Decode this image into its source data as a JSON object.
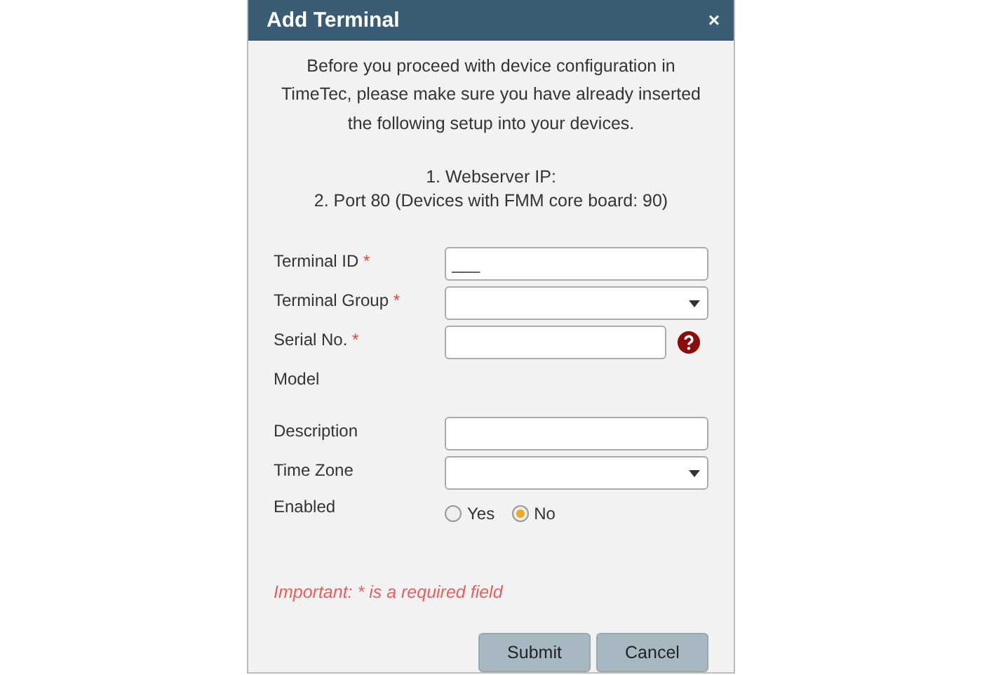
{
  "dialog": {
    "title": "Add Terminal",
    "close": "×"
  },
  "intro": [
    "Before you proceed with device configuration in TimeTec, please make sure you have already inserted the following setup into your devices."
  ],
  "setup_steps": [
    "1. Webserver IP:",
    "2. Port 80 (Devices with FMM core board: 90)"
  ],
  "fields": [
    {
      "label": "Terminal ID",
      "required_mark": "*",
      "kind": "text",
      "value": "___"
    },
    {
      "label": "Terminal Group",
      "required_mark": "*",
      "kind": "select"
    },
    {
      "label": "Serial No.",
      "required_mark": "*",
      "kind": "text",
      "help": true
    },
    {
      "label": "Model",
      "kind": "none"
    },
    {
      "label": "Description",
      "kind": "text"
    },
    {
      "label": "Time Zone",
      "kind": "select"
    },
    {
      "label": "Enabled",
      "kind": "radio",
      "options": [
        {
          "label": "Yes",
          "selected": false
        },
        {
          "label": "No",
          "selected": true
        }
      ]
    }
  ],
  "note": "Important: * is a required field",
  "buttons": [
    "Submit",
    "Cancel"
  ]
}
